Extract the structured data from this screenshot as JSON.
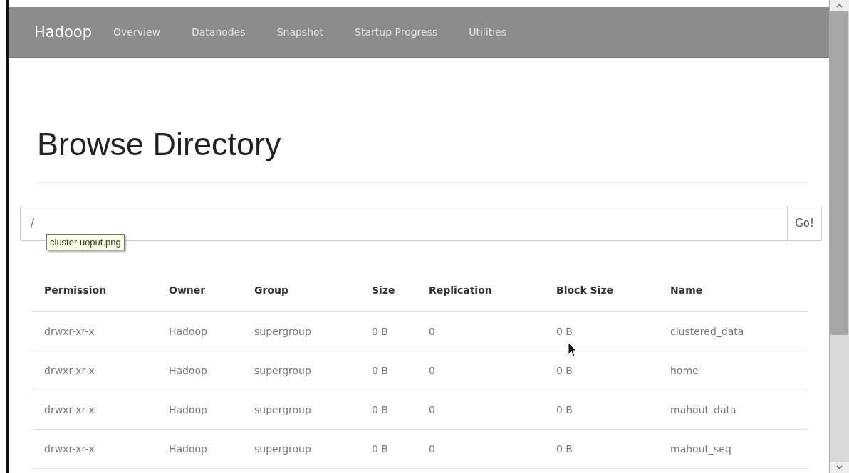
{
  "navbar": {
    "brand": "Hadoop",
    "items": [
      "Overview",
      "Datanodes",
      "Snapshot",
      "Startup Progress",
      "Utilities"
    ]
  },
  "heading": "Browse Directory",
  "path_field": {
    "value": "/",
    "button": "Go!"
  },
  "tooltip": "cluster uoput.png",
  "table": {
    "columns": [
      "Permission",
      "Owner",
      "Group",
      "Size",
      "Replication",
      "Block Size",
      "Name"
    ],
    "rows": [
      [
        "drwxr-xr-x",
        "Hadoop",
        "supergroup",
        "0 B",
        "0",
        "0 B",
        "clustered_data"
      ],
      [
        "drwxr-xr-x",
        "Hadoop",
        "supergroup",
        "0 B",
        "0",
        "0 B",
        "home"
      ],
      [
        "drwxr-xr-x",
        "Hadoop",
        "supergroup",
        "0 B",
        "0",
        "0 B",
        "mahout_data"
      ],
      [
        "drwxr-xr-x",
        "Hadoop",
        "supergroup",
        "0 B",
        "0",
        "0 B",
        "mahout_seq"
      ]
    ]
  }
}
